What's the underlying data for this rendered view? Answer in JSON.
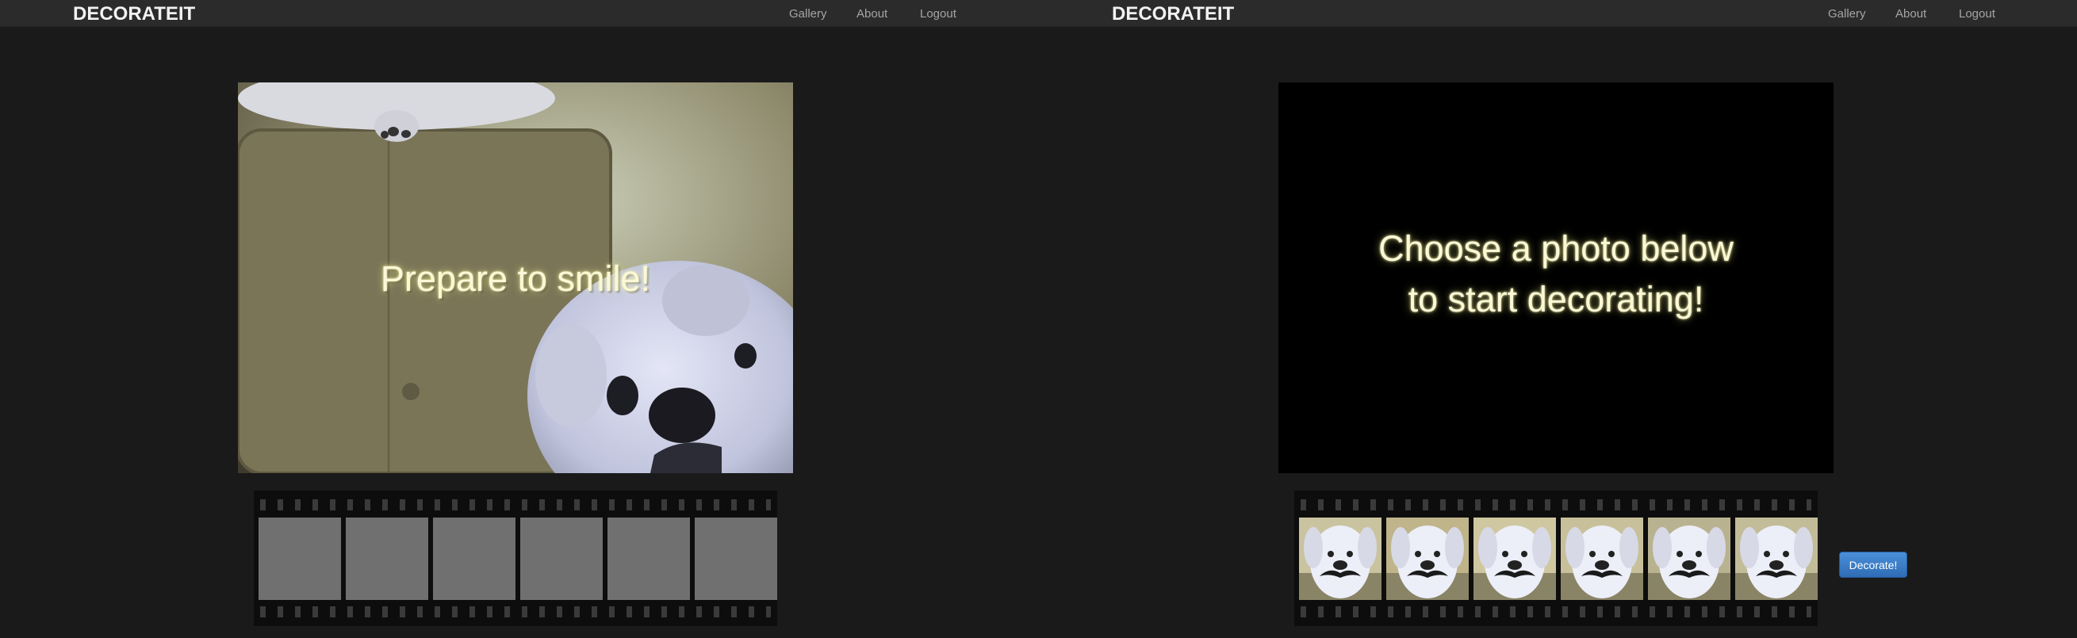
{
  "left": {
    "brand": "DECORATEIT",
    "nav": {
      "gallery": "Gallery",
      "about": "About",
      "logout": "Logout"
    },
    "stage_text": "Prepare to smile!"
  },
  "right": {
    "brand": "DECORATEIT",
    "nav": {
      "gallery": "Gallery",
      "about": "About",
      "logout": "Logout"
    },
    "stage_text_line1": "Choose a photo below",
    "stage_text_line2": "to start decorating!",
    "decorate_button": "Decorate!"
  },
  "colors": {
    "page_background": "#1a1a1a",
    "navbar": "#2b2b2b",
    "button_accent": "#3a7bc8",
    "glow_text": "#fbf8d8",
    "empty_frame": "#707070"
  }
}
